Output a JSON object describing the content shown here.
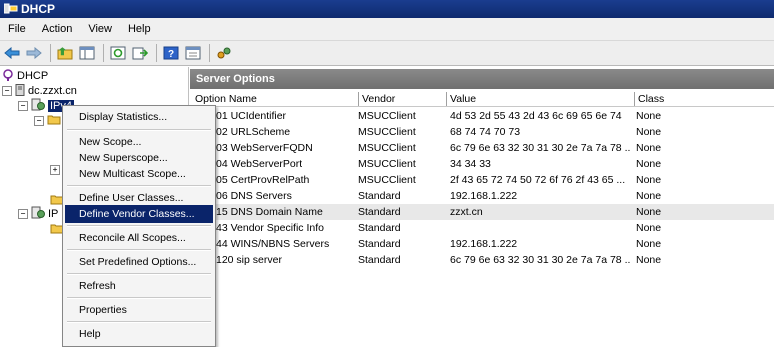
{
  "window": {
    "title": "DHCP"
  },
  "menu": [
    "File",
    "Action",
    "View",
    "Help"
  ],
  "tree": {
    "root": "DHCP",
    "server": "dc.zzxt.cn",
    "ipv4_label": "IPv4",
    "ip_label2": "IP"
  },
  "pane": {
    "title": "Server Options"
  },
  "columns": [
    "Option Name",
    "Vendor",
    "Value",
    "Class"
  ],
  "rows": [
    {
      "name": "01 UCIdentifier",
      "vendor": "MSUCClient",
      "value": "4d 53 2d 55 43 2d 43 6c 69 65 6e 74",
      "class": "None"
    },
    {
      "name": "02 URLScheme",
      "vendor": "MSUCClient",
      "value": "68 74 74 70 73",
      "class": "None"
    },
    {
      "name": "03 WebServerFQDN",
      "vendor": "MSUCClient",
      "value": "6c 79 6e 63 32 30 31 30 2e 7a 7a 78 ...",
      "class": "None"
    },
    {
      "name": "04 WebServerPort",
      "vendor": "MSUCClient",
      "value": "34 34 33",
      "class": "None"
    },
    {
      "name": "05 CertProvRelPath",
      "vendor": "MSUCClient",
      "value": "2f 43 65 72 74 50 72 6f 76 2f 43 65 ...",
      "class": "None"
    },
    {
      "name": "06 DNS Servers",
      "vendor": "Standard",
      "value": "192.168.1.222",
      "class": "None"
    },
    {
      "name": "15 DNS Domain Name",
      "vendor": "Standard",
      "value": "zzxt.cn",
      "class": "None"
    },
    {
      "name": "43 Vendor Specific Info",
      "vendor": "Standard",
      "value": "",
      "class": "None"
    },
    {
      "name": "44 WINS/NBNS Servers",
      "vendor": "Standard",
      "value": "192.168.1.222",
      "class": "None"
    },
    {
      "name": "120 sip server",
      "vendor": "Standard",
      "value": "6c 79 6e 63 32 30 31 30 2e 7a 7a 78 ...",
      "class": "None"
    }
  ],
  "context_menu": {
    "display_statistics": "Display Statistics...",
    "new_scope": "New Scope...",
    "new_superscope": "New Superscope...",
    "new_multicast_scope": "New Multicast Scope...",
    "define_user_classes": "Define User Classes...",
    "define_vendor_classes": "Define Vendor Classes...",
    "reconcile_all_scopes": "Reconcile All Scopes...",
    "set_predefined_options": "Set Predefined Options...",
    "refresh": "Refresh",
    "properties": "Properties",
    "help": "Help"
  },
  "icons": [
    "dhcp-app-icon",
    "back-arrow-icon",
    "forward-arrow-icon",
    "up-folder-icon",
    "show-hide-tree-icon",
    "refresh-icon",
    "export-list-icon",
    "help-icon",
    "properties-icon",
    "dhcp-tool-icon",
    "server-icon",
    "ipv4-icon",
    "folder-icon"
  ],
  "colors": {
    "title_bar": "#0e2a6e",
    "selection": "#0a246a",
    "pane_header": "#7a7a7a"
  }
}
